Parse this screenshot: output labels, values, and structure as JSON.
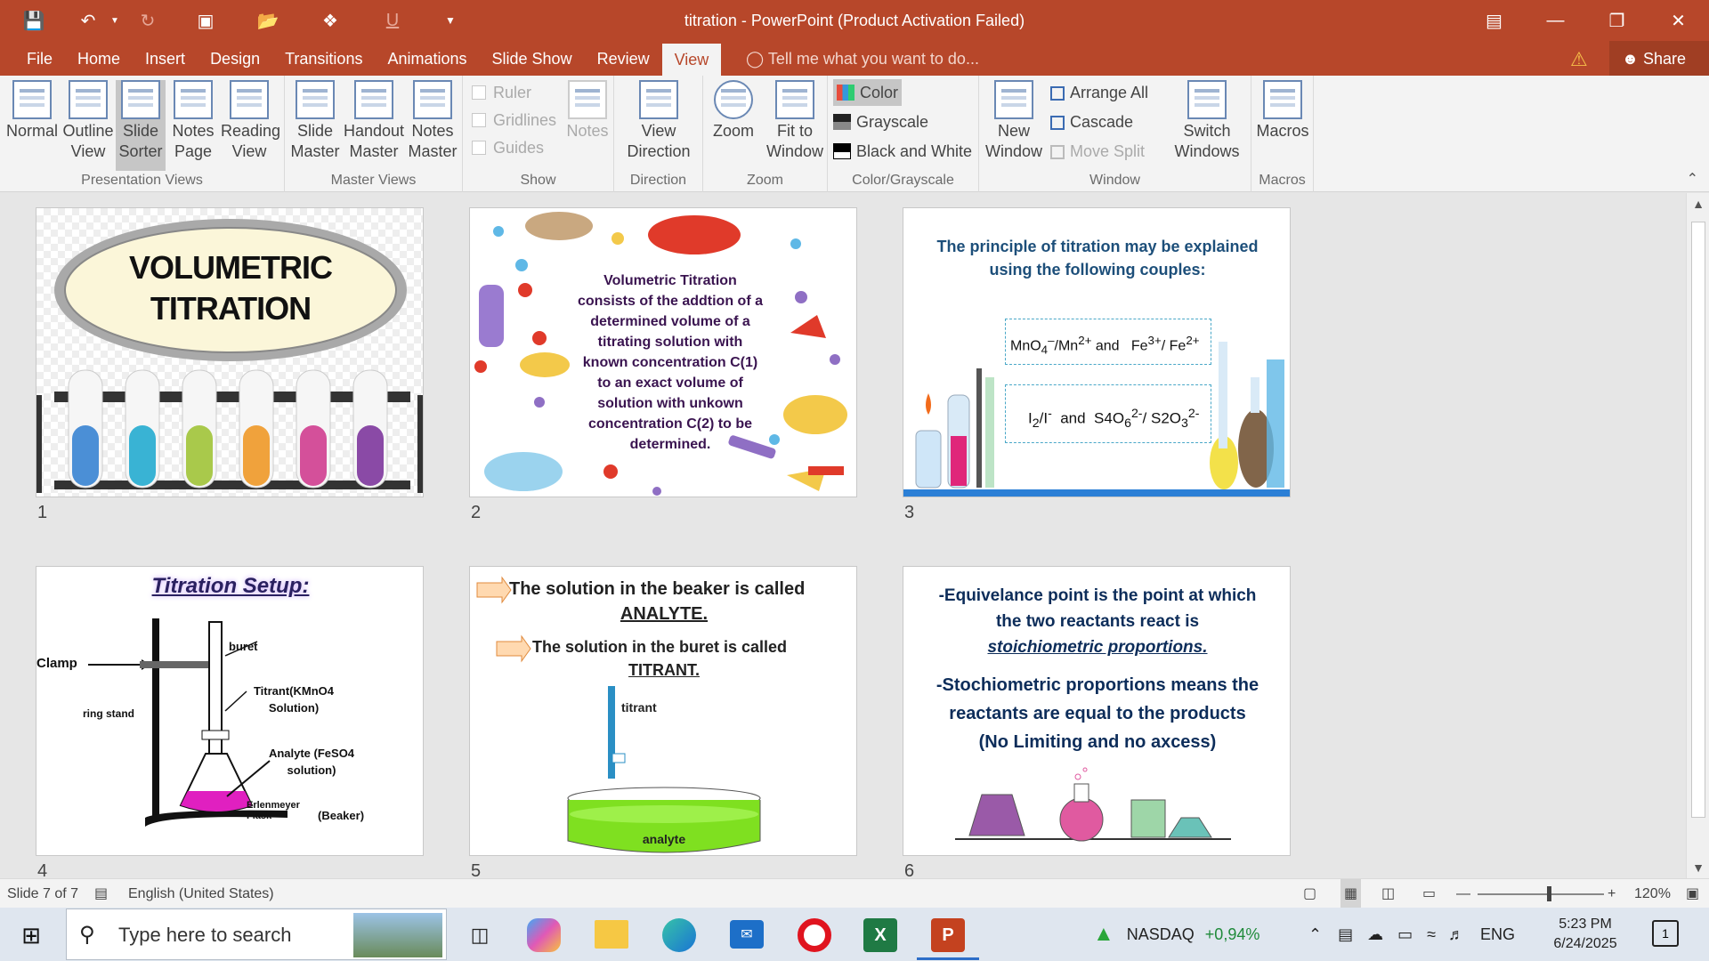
{
  "window": {
    "title": "titration - PowerPoint (Product Activation Failed)"
  },
  "menu": {
    "tabs": [
      "File",
      "Home",
      "Insert",
      "Design",
      "Transitions",
      "Animations",
      "Slide Show",
      "Review",
      "View"
    ],
    "active_tab": "View",
    "tell_me": "Tell me what you want to do...",
    "share": "Share"
  },
  "ribbon": {
    "presentation_views": {
      "label": "Presentation Views",
      "normal": "Normal",
      "outline": "Outline View",
      "slide_sorter": "Slide Sorter",
      "notes_page": "Notes Page",
      "reading_view": "Reading View"
    },
    "master_views": {
      "label": "Master Views",
      "slide": "Slide Master",
      "handout": "Handout Master",
      "notes": "Notes Master"
    },
    "show": {
      "label": "Show",
      "ruler": "Ruler",
      "gridlines": "Gridlines",
      "guides": "Guides",
      "notes": "Notes"
    },
    "direction": {
      "label": "Direction",
      "view_direction": "View Direction"
    },
    "zoom": {
      "label": "Zoom",
      "zoom": "Zoom",
      "fit": "Fit to Window"
    },
    "color": {
      "label": "Color/Grayscale",
      "color": "Color",
      "grayscale": "Grayscale",
      "bw": "Black and White"
    },
    "window": {
      "label": "Window",
      "new_window": "New Window",
      "arrange_all": "Arrange All",
      "cascade": "Cascade",
      "move_split": "Move Split",
      "switch_windows": "Switch Windows"
    },
    "macros": {
      "label": "Macros",
      "macros": "Macros"
    }
  },
  "slides": {
    "numbers": [
      "1",
      "2",
      "3",
      "4",
      "5",
      "6"
    ],
    "s1": {
      "title_line1": "VOLUMETRIC",
      "title_line2": "TITRATION"
    },
    "s2": {
      "text": "Volumetric Titration consists of the addtion of a determined volume of a titrating solution with known concentration C(1) to an exact volume of solution with unkown concentration C(2) to be determined."
    },
    "s3": {
      "heading": "The principle of titration may be explained using the following couples:",
      "couple1": "MnO4⁻ /Mn2+ and  Fe3+/ Fe2+",
      "couple2": "I2/I⁻  and  S4O62-/ S2O32-"
    },
    "s4": {
      "title": "Titration Setup:",
      "clamp": "Clamp",
      "buret": "buret",
      "ring_stand": "ring stand",
      "titrant": "Titrant(KMnO4 Solution)",
      "analyte": "Analyte (FeSO4 solution)",
      "flask": "Erlenmeyer Flask",
      "beaker": "(Beaker)"
    },
    "s5": {
      "line1": "The solution in the beaker is called",
      "line1b": "ANALYTE.",
      "line2": "The solution in the buret is called",
      "line2b": "TITRANT.",
      "titrant_label": "titrant",
      "analyte_label": "analyte"
    },
    "s6": {
      "p1a": "-Equivelance point is the point at which",
      "p1b": "the two reactants react  is",
      "p1c": "stoichiometric proportions.",
      "p2a": "-Stochiometric proportions means the",
      "p2b": "reactants are equal to the products",
      "p2c": "(No Limiting and no axcess)"
    }
  },
  "status": {
    "slide_info": "Slide 7 of 7",
    "language": "English (United States)",
    "zoom": "120%"
  },
  "taskbar": {
    "search_placeholder": "Type here to search",
    "ticker_name": "NASDAQ",
    "ticker_change": "+0,94%",
    "lang": "ENG",
    "time": "5:23 PM",
    "date": "6/24/2025",
    "notif_count": "1"
  },
  "colors": {
    "accent": "#b7472a",
    "ribbon": "#f3f3f3"
  }
}
